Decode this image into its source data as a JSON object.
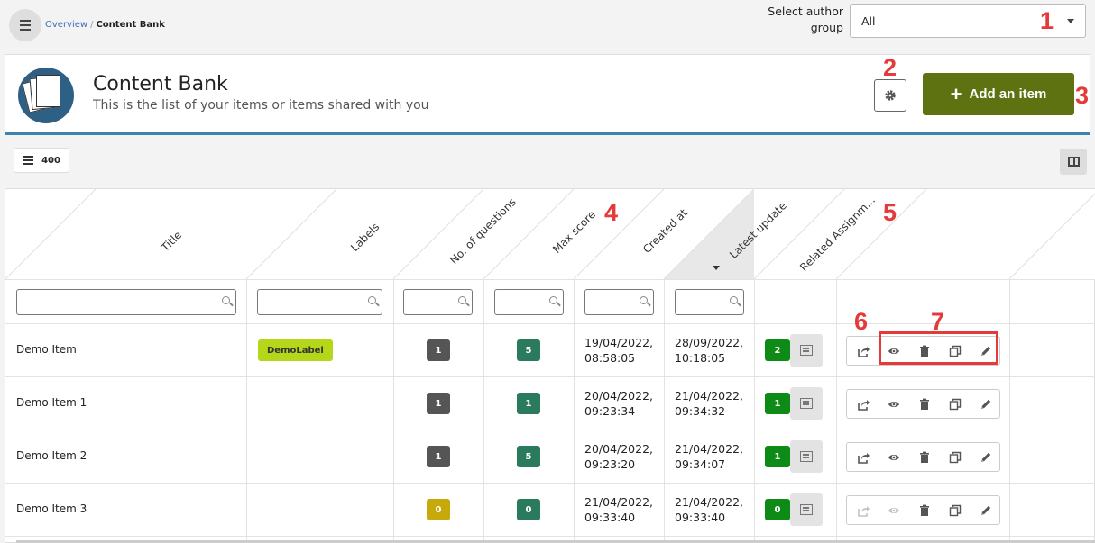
{
  "breadcrumb": {
    "overview": "Overview",
    "separator": "/",
    "current": "Content Bank"
  },
  "author_group": {
    "label": "Select author group",
    "value": "All"
  },
  "header": {
    "title": "Content Bank",
    "subtitle": "This is the list of your items or items shared with you",
    "add_button": "Add an item"
  },
  "toolbar": {
    "count": "400"
  },
  "annotations": [
    "1",
    "2",
    "3",
    "4",
    "5",
    "6",
    "7"
  ],
  "columns": [
    "Title",
    "Labels",
    "No. of questions",
    "Max score",
    "Created at",
    "Latest update",
    "Related Assignm..."
  ],
  "sorted_column": "Latest update",
  "colors": {
    "accent": "#5f7212",
    "header_border": "#3f83b0",
    "annotation": "#e43a3a",
    "label_badge": "#b5d71a",
    "question_badge": "#555555",
    "question_badge_zero": "#c8a90c",
    "score_badge": "#2a7a5e",
    "related_badge": "#0e8a16"
  },
  "rows": [
    {
      "title": "Demo Item",
      "label": "DemoLabel",
      "questions": "1",
      "score": "5",
      "created": "19/04/2022,\n08:58:05",
      "updated": "28/09/2022,\n10:18:05",
      "related": "2"
    },
    {
      "title": "Demo Item 1",
      "label": "",
      "questions": "1",
      "score": "1",
      "created": "20/04/2022,\n09:23:34",
      "updated": "21/04/2022,\n09:34:32",
      "related": "1"
    },
    {
      "title": "Demo Item 2",
      "label": "",
      "questions": "1",
      "score": "5",
      "created": "20/04/2022,\n09:23:20",
      "updated": "21/04/2022,\n09:34:07",
      "related": "1"
    },
    {
      "title": "Demo Item 3",
      "label": "",
      "questions": "0",
      "score": "0",
      "created": "21/04/2022,\n09:33:40",
      "updated": "21/04/2022,\n09:33:40",
      "related": "0"
    }
  ],
  "row_action_icons": [
    "share-icon",
    "eye-icon",
    "trash-icon",
    "duplicate-icon",
    "pencil-icon"
  ]
}
